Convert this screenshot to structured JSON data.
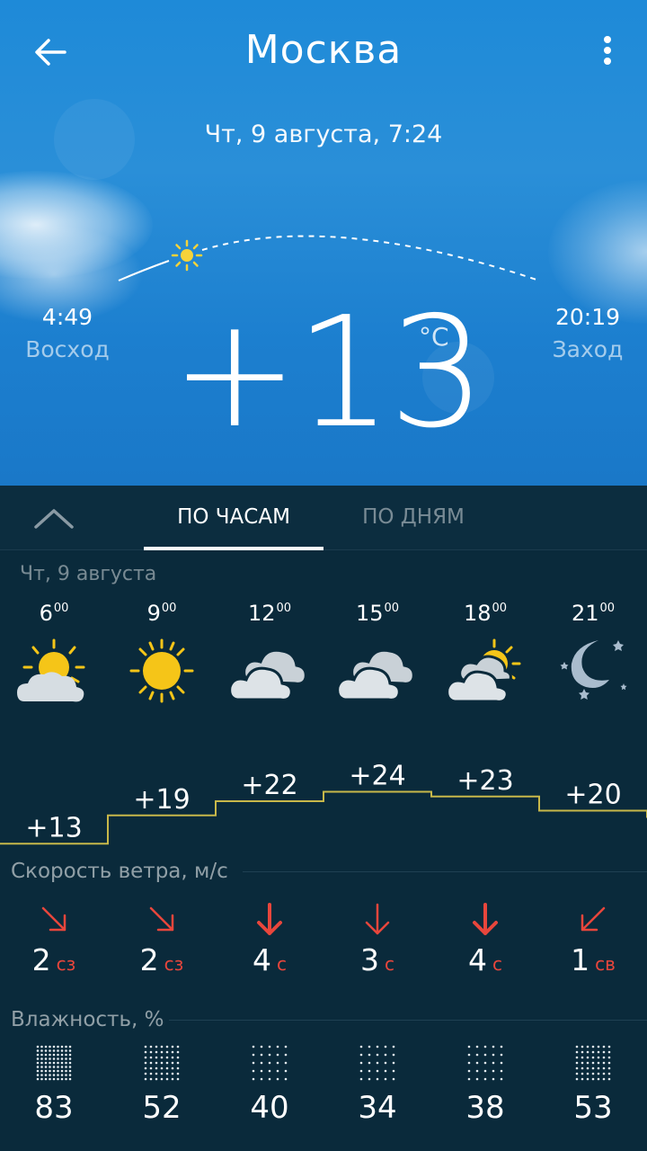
{
  "header": {
    "city": "Москва",
    "datetime": "Чт, 9 августа, 7:24"
  },
  "sun": {
    "sunrise_time": "4:49",
    "sunrise_label": "Восход",
    "sunset_time": "20:19",
    "sunset_label": "Заход"
  },
  "current": {
    "temperature": "+13",
    "unit": "°C"
  },
  "tabs": {
    "hourly": "ПО ЧАСАМ",
    "daily": "ПО ДНЯМ",
    "active": "hourly"
  },
  "forecast": {
    "day_label": "Чт, 9 августа",
    "hours": [
      {
        "h": "6",
        "m": "00",
        "icon": "partly-cloudy-icon",
        "temp": "+13"
      },
      {
        "h": "9",
        "m": "00",
        "icon": "sun-icon",
        "temp": "+19"
      },
      {
        "h": "12",
        "m": "00",
        "icon": "cloudy-icon",
        "temp": "+22"
      },
      {
        "h": "15",
        "m": "00",
        "icon": "cloudy-icon",
        "temp": "+24"
      },
      {
        "h": "18",
        "m": "00",
        "icon": "partly-cloudy-icon",
        "temp": "+23"
      },
      {
        "h": "21",
        "m": "00",
        "icon": "moon-stars-icon",
        "temp": "+20"
      }
    ]
  },
  "wind": {
    "title": "Скорость ветра, м/с",
    "items": [
      {
        "speed": "2",
        "dir": "сз",
        "arrow": "down-right-arrow-icon"
      },
      {
        "speed": "2",
        "dir": "сз",
        "arrow": "down-right-arrow-icon"
      },
      {
        "speed": "4",
        "dir": "с",
        "arrow": "down-arrow-icon"
      },
      {
        "speed": "3",
        "dir": "с",
        "arrow": "down-arrow-icon"
      },
      {
        "speed": "4",
        "dir": "с",
        "arrow": "down-arrow-icon"
      },
      {
        "speed": "1",
        "dir": "св",
        "arrow": "down-left-arrow-icon"
      }
    ]
  },
  "humidity": {
    "title": "Влажность, %",
    "items": [
      "83",
      "52",
      "40",
      "34",
      "38",
      "53"
    ]
  },
  "colors": {
    "accent_red": "#e8463c",
    "temp_line": "#c8b84a",
    "panel": "#0a2a3b"
  }
}
